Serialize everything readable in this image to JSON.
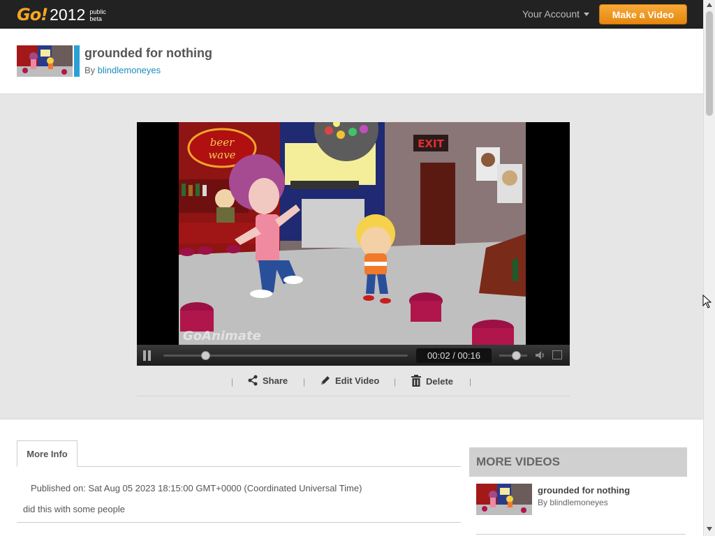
{
  "brand": {
    "logo": "Go!",
    "year": "2012",
    "tag": "public beta"
  },
  "nav": {
    "account": "Your Account",
    "make_video": "Make a Video"
  },
  "video": {
    "title": "grounded for nothing",
    "by_prefix": "By",
    "author": "blindlemoneyes",
    "watermark": "GoAnimate",
    "time_current": "00:02",
    "time_total": "00:16",
    "progress": 0.17,
    "volume": 0.6
  },
  "actions": {
    "share": "Share",
    "edit": "Edit Video",
    "delete": "Delete"
  },
  "info": {
    "tab_label": "More Info",
    "published": "Published on: Sat Aug 05 2023 18:15:00 GMT+0000 (Coordinated Universal Time)",
    "description": "did this with some people"
  },
  "more_videos": {
    "heading": "MORE VIDEOS",
    "items": [
      {
        "title": "grounded for nothing",
        "by": "By blindlemoneyes"
      }
    ]
  },
  "colors": {
    "accent": "#f5a623",
    "link": "#1a8bc0",
    "header_bg": "#222222"
  },
  "icons": [
    "caret-down-icon",
    "pause-icon",
    "speaker-icon",
    "fullscreen-icon",
    "share-icon",
    "pencil-icon",
    "trash-icon",
    "mouse-cursor-icon"
  ]
}
